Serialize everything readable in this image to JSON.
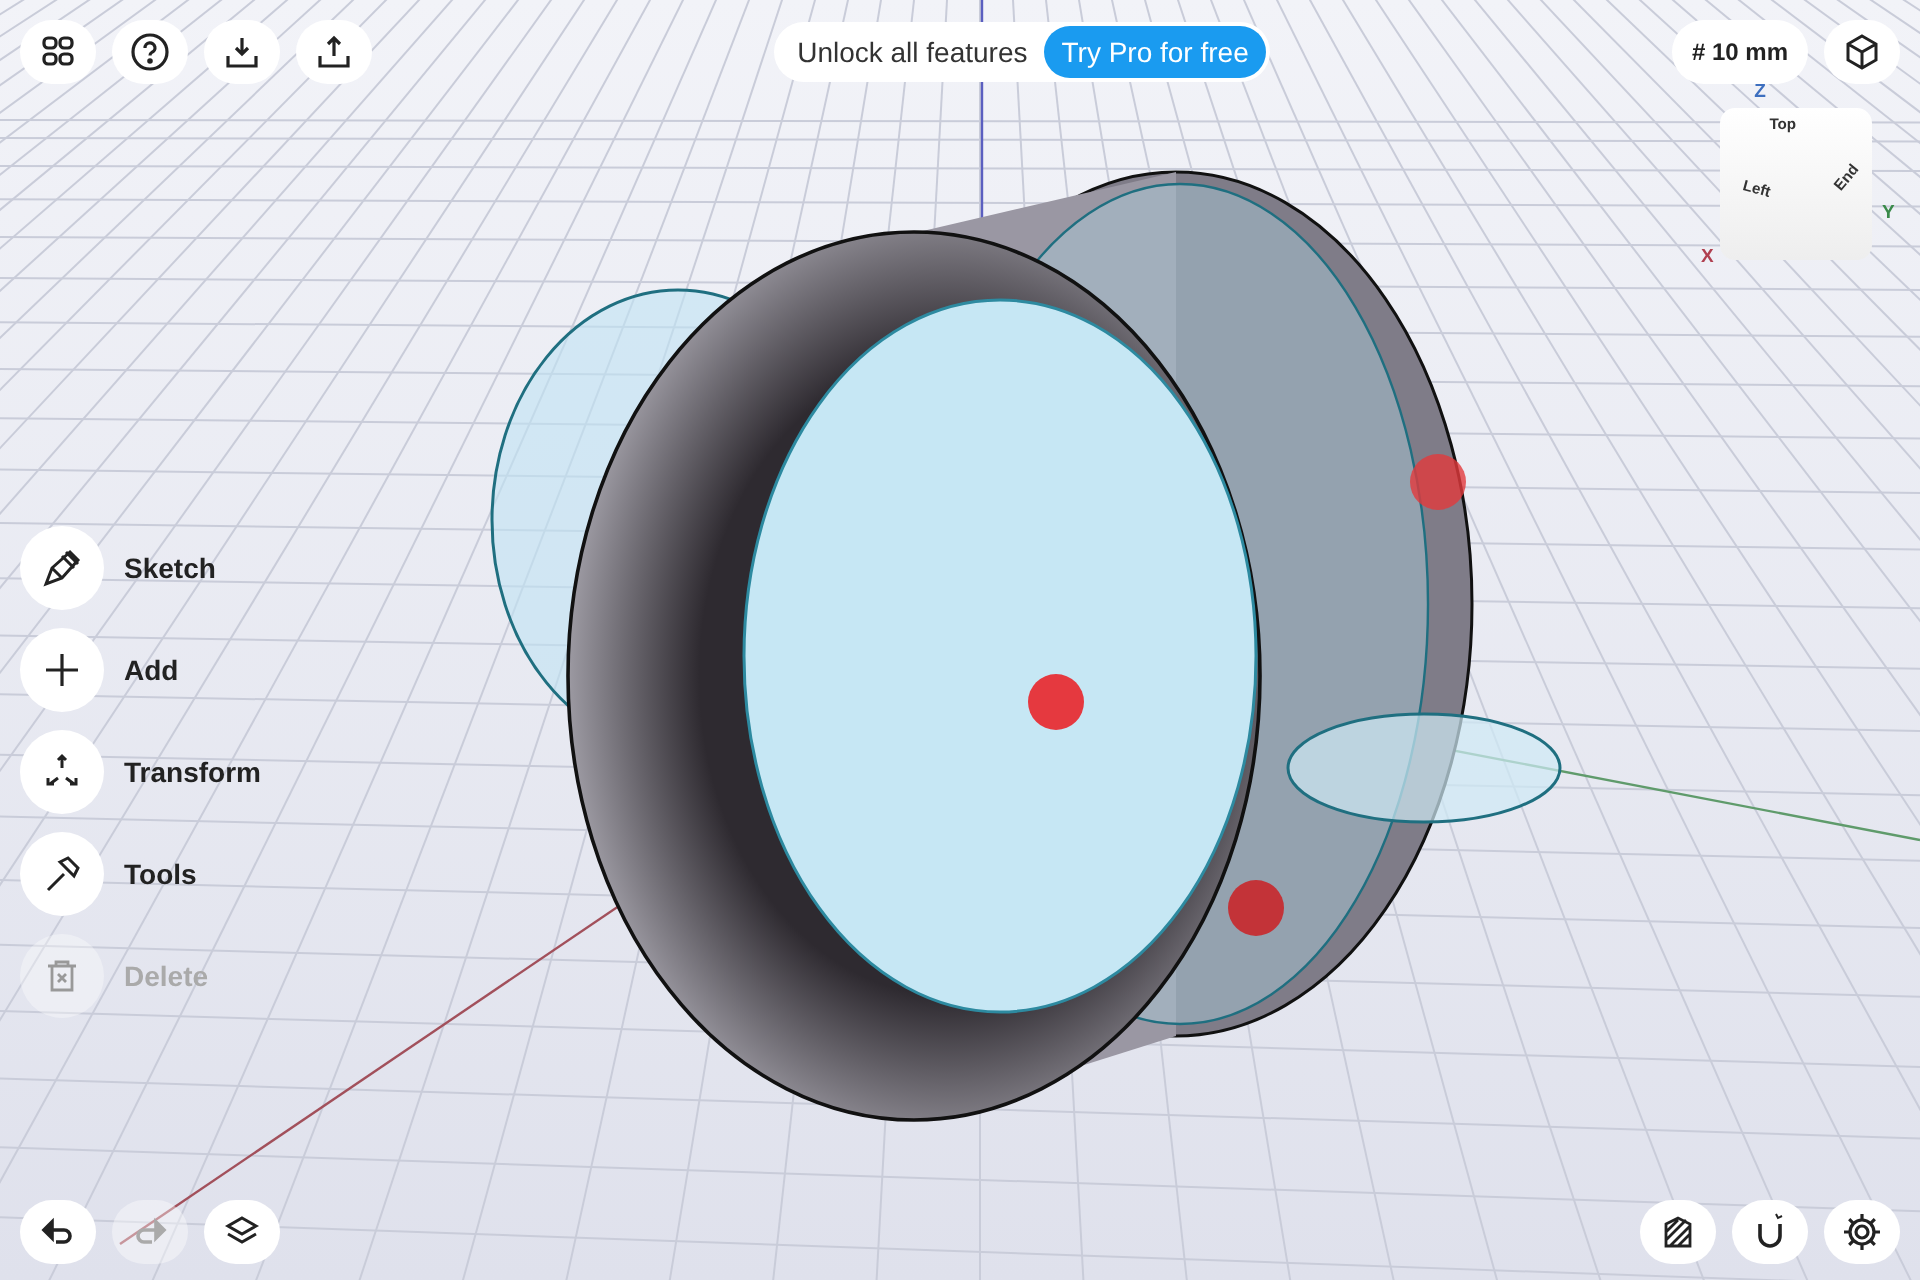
{
  "top_left_buttons": [
    {
      "kind": "grid"
    },
    {
      "kind": "help"
    },
    {
      "kind": "import"
    },
    {
      "kind": "export"
    }
  ],
  "promo": {
    "text": "Unlock all features",
    "button": "Try Pro for free"
  },
  "grid_size": "# 10 mm",
  "view_cube": {
    "axes": {
      "z": "Z",
      "x": "X",
      "y": "Y"
    },
    "faces": {
      "top": "Top",
      "left": "Left",
      "end": "End"
    }
  },
  "tools": [
    {
      "kind": "sketch",
      "label": "Sketch",
      "disabled": false
    },
    {
      "kind": "add",
      "label": "Add",
      "disabled": false
    },
    {
      "kind": "transform",
      "label": "Transform",
      "disabled": false
    },
    {
      "kind": "tools",
      "label": "Tools",
      "disabled": false
    },
    {
      "kind": "delete",
      "label": "Delete",
      "disabled": true
    }
  ],
  "bottom_left_buttons": [
    {
      "kind": "undo",
      "disabled": false
    },
    {
      "kind": "redo",
      "disabled": true
    },
    {
      "kind": "layers",
      "disabled": false
    }
  ],
  "bottom_right_buttons": [
    {
      "kind": "material",
      "disabled": false
    },
    {
      "kind": "snap",
      "disabled": false
    },
    {
      "kind": "settings",
      "disabled": false
    }
  ]
}
